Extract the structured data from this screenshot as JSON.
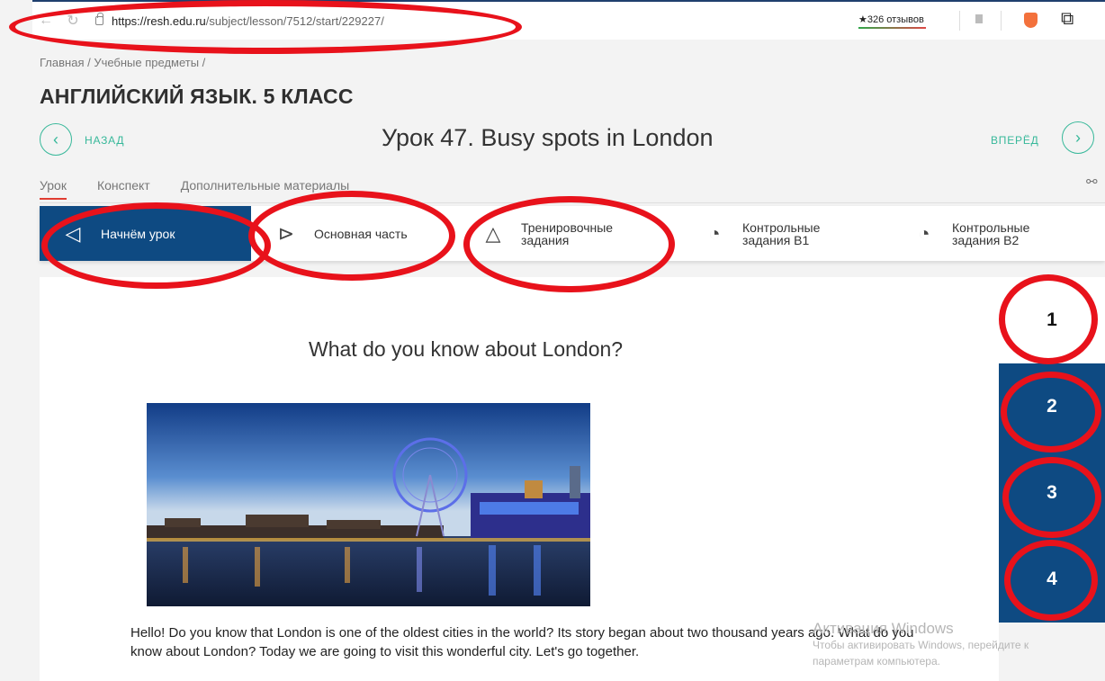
{
  "browser": {
    "url_host": "https://resh.edu.ru",
    "url_path": "/subject/lesson/7512/start/229227/",
    "rating": "★326 отзывов"
  },
  "breadcrumb": "Главная / Учебные предметы /",
  "subject_title": "АНГЛИЙСКИЙ ЯЗЫК. 5 КЛАСС",
  "nav": {
    "back": "НАЗАД",
    "forward": "ВПЕРЁД"
  },
  "lesson_title": "Урок 47. Busy spots in London",
  "tabs": [
    "Урок",
    "Конспект",
    "Дополнительные материалы"
  ],
  "steps": [
    {
      "label": "Начнём урок",
      "icon": "megaphone-icon"
    },
    {
      "label": "Основная часть",
      "icon": "play-icon"
    },
    {
      "label": "Тренировочные задания",
      "icon": "pyramid-icon"
    },
    {
      "label": "Контрольные задания В1",
      "icon": "stopwatch-icon"
    },
    {
      "label": "Контрольные задания В2",
      "icon": "stopwatch-icon"
    }
  ],
  "content": {
    "question": "What do you know about London?",
    "paragraph": "Hello! Do you know that London is one of the oldest cities in the world? Its story began about two thousand years ago. What do you know about London? Today we are going to visit this wonderful city. Let's go together."
  },
  "watermark": {
    "line1": "Активация Windows",
    "line2": "Чтобы активировать Windows, перейдите к",
    "line3": "параметрам компьютера."
  },
  "pager": [
    "1",
    "2",
    "3",
    "4"
  ],
  "colors": {
    "accent": "#37b89a",
    "active": "#0e4a82",
    "annotation": "#e8121b"
  }
}
